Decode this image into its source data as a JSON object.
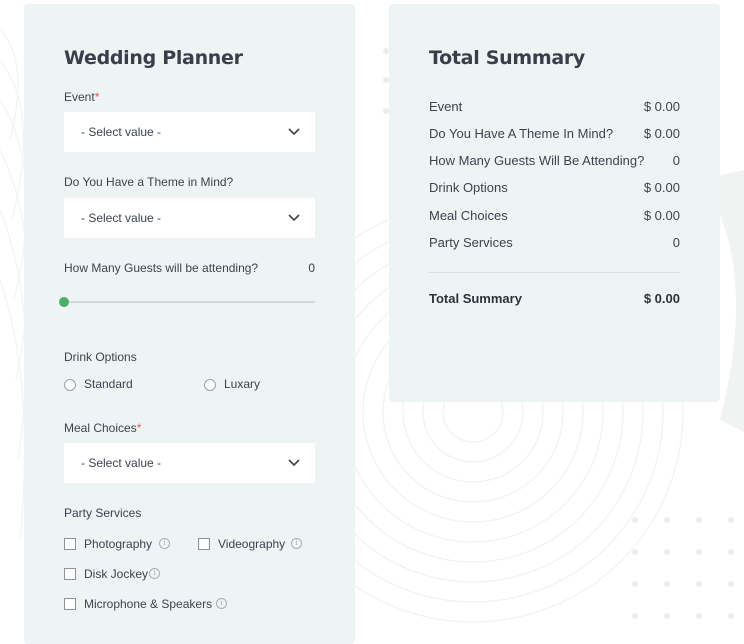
{
  "planner": {
    "title": "Wedding Planner",
    "event": {
      "label": "Event",
      "required_mark": "*",
      "value": "- Select value -"
    },
    "theme": {
      "label": "Do You Have a Theme in Mind?",
      "value": "- Select value -"
    },
    "guests": {
      "label": "How Many Guests will be attending?",
      "value": "0",
      "slider_fraction": 0
    },
    "drinks": {
      "label": "Drink Options",
      "options": [
        "Standard",
        "Luxary"
      ]
    },
    "meal": {
      "label": "Meal Choices",
      "required_mark": "*",
      "value": "- Select value -"
    },
    "party_services": {
      "label": "Party Services",
      "options": [
        "Photography",
        "Videography",
        "Disk Jockey",
        "Microphone & Speakers"
      ],
      "info_glyph": "i"
    }
  },
  "summary": {
    "title": "Total Summary",
    "rows": [
      {
        "label": "Event",
        "value": "$ 0.00"
      },
      {
        "label": "Do You Have A Theme In Mind?",
        "value": "$ 0.00"
      },
      {
        "label": "How Many Guests Will Be Attending?",
        "value": "0"
      },
      {
        "label": "Drink Options",
        "value": "$ 0.00"
      },
      {
        "label": "Meal Choices",
        "value": "$ 0.00"
      },
      {
        "label": "Party Services",
        "value": "0"
      }
    ],
    "total": {
      "label": "Total Summary",
      "value": "$ 0.00"
    }
  },
  "colors": {
    "card_background": "#eef3f3",
    "accent_green": "#4caf67",
    "required_red": "#e05a5a",
    "text": "#3f4350"
  },
  "icons": {
    "dropdown": "chevron-down-icon",
    "info": "info-icon"
  }
}
